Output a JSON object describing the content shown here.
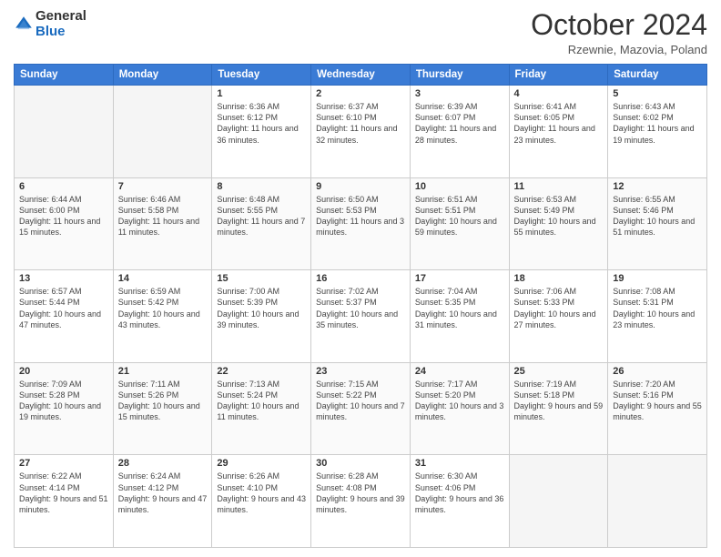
{
  "logo": {
    "general": "General",
    "blue": "Blue"
  },
  "header": {
    "month_year": "October 2024",
    "location": "Rzewnie, Mazovia, Poland"
  },
  "days_of_week": [
    "Sunday",
    "Monday",
    "Tuesday",
    "Wednesday",
    "Thursday",
    "Friday",
    "Saturday"
  ],
  "weeks": [
    [
      {
        "day": "",
        "sunrise": "",
        "sunset": "",
        "daylight": ""
      },
      {
        "day": "",
        "sunrise": "",
        "sunset": "",
        "daylight": ""
      },
      {
        "day": "1",
        "sunrise": "Sunrise: 6:36 AM",
        "sunset": "Sunset: 6:12 PM",
        "daylight": "Daylight: 11 hours and 36 minutes."
      },
      {
        "day": "2",
        "sunrise": "Sunrise: 6:37 AM",
        "sunset": "Sunset: 6:10 PM",
        "daylight": "Daylight: 11 hours and 32 minutes."
      },
      {
        "day": "3",
        "sunrise": "Sunrise: 6:39 AM",
        "sunset": "Sunset: 6:07 PM",
        "daylight": "Daylight: 11 hours and 28 minutes."
      },
      {
        "day": "4",
        "sunrise": "Sunrise: 6:41 AM",
        "sunset": "Sunset: 6:05 PM",
        "daylight": "Daylight: 11 hours and 23 minutes."
      },
      {
        "day": "5",
        "sunrise": "Sunrise: 6:43 AM",
        "sunset": "Sunset: 6:02 PM",
        "daylight": "Daylight: 11 hours and 19 minutes."
      }
    ],
    [
      {
        "day": "6",
        "sunrise": "Sunrise: 6:44 AM",
        "sunset": "Sunset: 6:00 PM",
        "daylight": "Daylight: 11 hours and 15 minutes."
      },
      {
        "day": "7",
        "sunrise": "Sunrise: 6:46 AM",
        "sunset": "Sunset: 5:58 PM",
        "daylight": "Daylight: 11 hours and 11 minutes."
      },
      {
        "day": "8",
        "sunrise": "Sunrise: 6:48 AM",
        "sunset": "Sunset: 5:55 PM",
        "daylight": "Daylight: 11 hours and 7 minutes."
      },
      {
        "day": "9",
        "sunrise": "Sunrise: 6:50 AM",
        "sunset": "Sunset: 5:53 PM",
        "daylight": "Daylight: 11 hours and 3 minutes."
      },
      {
        "day": "10",
        "sunrise": "Sunrise: 6:51 AM",
        "sunset": "Sunset: 5:51 PM",
        "daylight": "Daylight: 10 hours and 59 minutes."
      },
      {
        "day": "11",
        "sunrise": "Sunrise: 6:53 AM",
        "sunset": "Sunset: 5:49 PM",
        "daylight": "Daylight: 10 hours and 55 minutes."
      },
      {
        "day": "12",
        "sunrise": "Sunrise: 6:55 AM",
        "sunset": "Sunset: 5:46 PM",
        "daylight": "Daylight: 10 hours and 51 minutes."
      }
    ],
    [
      {
        "day": "13",
        "sunrise": "Sunrise: 6:57 AM",
        "sunset": "Sunset: 5:44 PM",
        "daylight": "Daylight: 10 hours and 47 minutes."
      },
      {
        "day": "14",
        "sunrise": "Sunrise: 6:59 AM",
        "sunset": "Sunset: 5:42 PM",
        "daylight": "Daylight: 10 hours and 43 minutes."
      },
      {
        "day": "15",
        "sunrise": "Sunrise: 7:00 AM",
        "sunset": "Sunset: 5:39 PM",
        "daylight": "Daylight: 10 hours and 39 minutes."
      },
      {
        "day": "16",
        "sunrise": "Sunrise: 7:02 AM",
        "sunset": "Sunset: 5:37 PM",
        "daylight": "Daylight: 10 hours and 35 minutes."
      },
      {
        "day": "17",
        "sunrise": "Sunrise: 7:04 AM",
        "sunset": "Sunset: 5:35 PM",
        "daylight": "Daylight: 10 hours and 31 minutes."
      },
      {
        "day": "18",
        "sunrise": "Sunrise: 7:06 AM",
        "sunset": "Sunset: 5:33 PM",
        "daylight": "Daylight: 10 hours and 27 minutes."
      },
      {
        "day": "19",
        "sunrise": "Sunrise: 7:08 AM",
        "sunset": "Sunset: 5:31 PM",
        "daylight": "Daylight: 10 hours and 23 minutes."
      }
    ],
    [
      {
        "day": "20",
        "sunrise": "Sunrise: 7:09 AM",
        "sunset": "Sunset: 5:28 PM",
        "daylight": "Daylight: 10 hours and 19 minutes."
      },
      {
        "day": "21",
        "sunrise": "Sunrise: 7:11 AM",
        "sunset": "Sunset: 5:26 PM",
        "daylight": "Daylight: 10 hours and 15 minutes."
      },
      {
        "day": "22",
        "sunrise": "Sunrise: 7:13 AM",
        "sunset": "Sunset: 5:24 PM",
        "daylight": "Daylight: 10 hours and 11 minutes."
      },
      {
        "day": "23",
        "sunrise": "Sunrise: 7:15 AM",
        "sunset": "Sunset: 5:22 PM",
        "daylight": "Daylight: 10 hours and 7 minutes."
      },
      {
        "day": "24",
        "sunrise": "Sunrise: 7:17 AM",
        "sunset": "Sunset: 5:20 PM",
        "daylight": "Daylight: 10 hours and 3 minutes."
      },
      {
        "day": "25",
        "sunrise": "Sunrise: 7:19 AM",
        "sunset": "Sunset: 5:18 PM",
        "daylight": "Daylight: 9 hours and 59 minutes."
      },
      {
        "day": "26",
        "sunrise": "Sunrise: 7:20 AM",
        "sunset": "Sunset: 5:16 PM",
        "daylight": "Daylight: 9 hours and 55 minutes."
      }
    ],
    [
      {
        "day": "27",
        "sunrise": "Sunrise: 6:22 AM",
        "sunset": "Sunset: 4:14 PM",
        "daylight": "Daylight: 9 hours and 51 minutes."
      },
      {
        "day": "28",
        "sunrise": "Sunrise: 6:24 AM",
        "sunset": "Sunset: 4:12 PM",
        "daylight": "Daylight: 9 hours and 47 minutes."
      },
      {
        "day": "29",
        "sunrise": "Sunrise: 6:26 AM",
        "sunset": "Sunset: 4:10 PM",
        "daylight": "Daylight: 9 hours and 43 minutes."
      },
      {
        "day": "30",
        "sunrise": "Sunrise: 6:28 AM",
        "sunset": "Sunset: 4:08 PM",
        "daylight": "Daylight: 9 hours and 39 minutes."
      },
      {
        "day": "31",
        "sunrise": "Sunrise: 6:30 AM",
        "sunset": "Sunset: 4:06 PM",
        "daylight": "Daylight: 9 hours and 36 minutes."
      },
      {
        "day": "",
        "sunrise": "",
        "sunset": "",
        "daylight": ""
      },
      {
        "day": "",
        "sunrise": "",
        "sunset": "",
        "daylight": ""
      }
    ]
  ]
}
